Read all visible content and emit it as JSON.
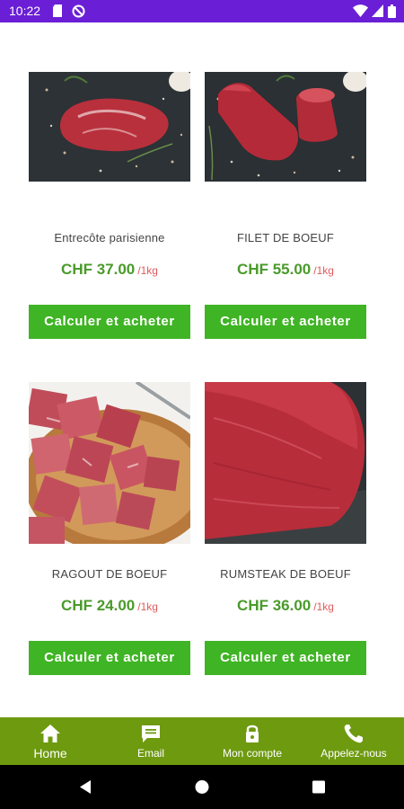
{
  "status_bar": {
    "time": "10:22",
    "background": "#6a1fd6"
  },
  "products": [
    {
      "name": "Entrecôte parisienne",
      "price": "CHF 37.00",
      "unit": "/1kg",
      "button_label": "Calculer et acheter",
      "image": "beef-entrecote-photo"
    },
    {
      "name": "FILET DE BOEUF",
      "price": "CHF 55.00",
      "unit": "/1kg",
      "button_label": "Calculer et acheter",
      "image": "beef-filet-photo"
    },
    {
      "name": "RAGOUT DE BOEUF",
      "price": "CHF 24.00",
      "unit": "/1kg",
      "button_label": "Calculer et acheter",
      "image": "beef-ragout-photo"
    },
    {
      "name": "RUMSTEAK DE BOEUF",
      "price": "CHF 36.00",
      "unit": "/1kg",
      "button_label": "Calculer et acheter",
      "image": "beef-rumsteak-photo"
    }
  ],
  "bottom_nav": {
    "background": "#6e9a10",
    "items": [
      {
        "label": "Home",
        "icon": "home-icon"
      },
      {
        "label": "Email",
        "icon": "email-icon"
      },
      {
        "label": "Mon compte",
        "icon": "lock-icon"
      },
      {
        "label": "Appelez-nous",
        "icon": "phone-icon"
      }
    ]
  },
  "colors": {
    "price_green": "#4a9a2a",
    "unit_red": "#e25a5a",
    "button_green": "#3fb424"
  }
}
